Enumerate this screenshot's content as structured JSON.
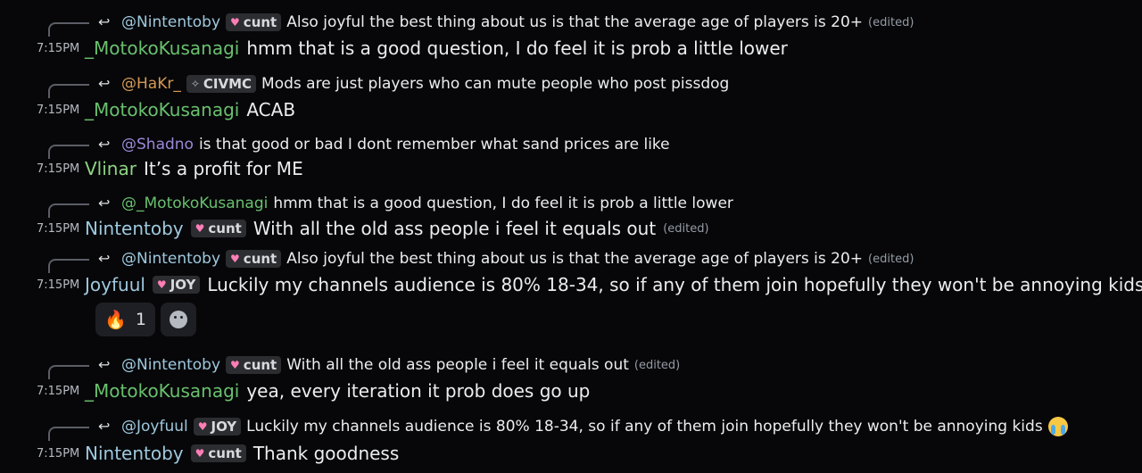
{
  "messages": [
    {
      "reply": {
        "mention": "@Nintentoby",
        "tag": "cunt",
        "text": "Also joyful the best thing about us is that the average age of players is 20+",
        "edited": "(edited)"
      },
      "time": "7:15PM",
      "author": "_MotokoKusanagi",
      "text": "hmm that is a good question, I do feel it is prob a little lower"
    },
    {
      "reply": {
        "mention": "@HaKr_",
        "tag": "CIVMC",
        "text": "Mods are just players who can mute people who post pissdog"
      },
      "time": "7:15PM",
      "author": "_MotokoKusanagi",
      "text": "ACAB"
    },
    {
      "reply": {
        "mention": "@Shadno",
        "text": "is that good or bad I dont remember what sand prices are like"
      },
      "time": "7:15PM",
      "author": "Vlinar",
      "text": "It’s a profit for ME"
    },
    {
      "reply": {
        "mention": "@_MotokoKusanagi",
        "text": "hmm that is a good question, I do feel it is prob a little lower"
      },
      "time": "7:15PM",
      "author": "Nintentoby",
      "author_tag": "cunt",
      "text": "With all the old ass people i feel it equals out",
      "edited": "(edited)"
    },
    {
      "reply": {
        "mention": "@Nintentoby",
        "tag": "cunt",
        "text": "Also joyful the best thing about us is that the average age of players is 20+",
        "edited": "(edited)"
      },
      "time": "7:15PM",
      "author": "Joyfuul",
      "author_tag": "JOY",
      "text": "Luckily my channels audience is 80% 18-34, so if any of them join hopefully they won't be annoying kids",
      "reaction": {
        "count": "1"
      }
    },
    {
      "reply": {
        "mention": "@Nintentoby",
        "tag": "cunt",
        "text": "With all the old ass people i feel it equals out",
        "edited": "(edited)"
      },
      "time": "7:15PM",
      "author": "_MotokoKusanagi",
      "text": "yea, every iteration it prob does go up"
    },
    {
      "reply": {
        "mention": "@Joyfuul",
        "tag": "JOY",
        "text": "Luckily my channels audience is 80% 18-34, so if any of them join hopefully they won't be annoying kids"
      },
      "time": "7:15PM",
      "author": "Nintentoby",
      "author_tag": "cunt",
      "text": "Thank goodness"
    }
  ],
  "icons": {
    "reply": "reply-arrow-icon",
    "heart": "heart-icon",
    "spark": "sparkle-icon",
    "fire": "fire-emoji",
    "cry": "loudly-crying-face-emoji",
    "add_reaction": "add-reaction-icon"
  },
  "colors": {
    "background": "#070709",
    "green_name": "#69c06e",
    "blue_name": "#9ec8de",
    "orange_name": "#d49a55",
    "purple_name": "#9a89d8"
  }
}
